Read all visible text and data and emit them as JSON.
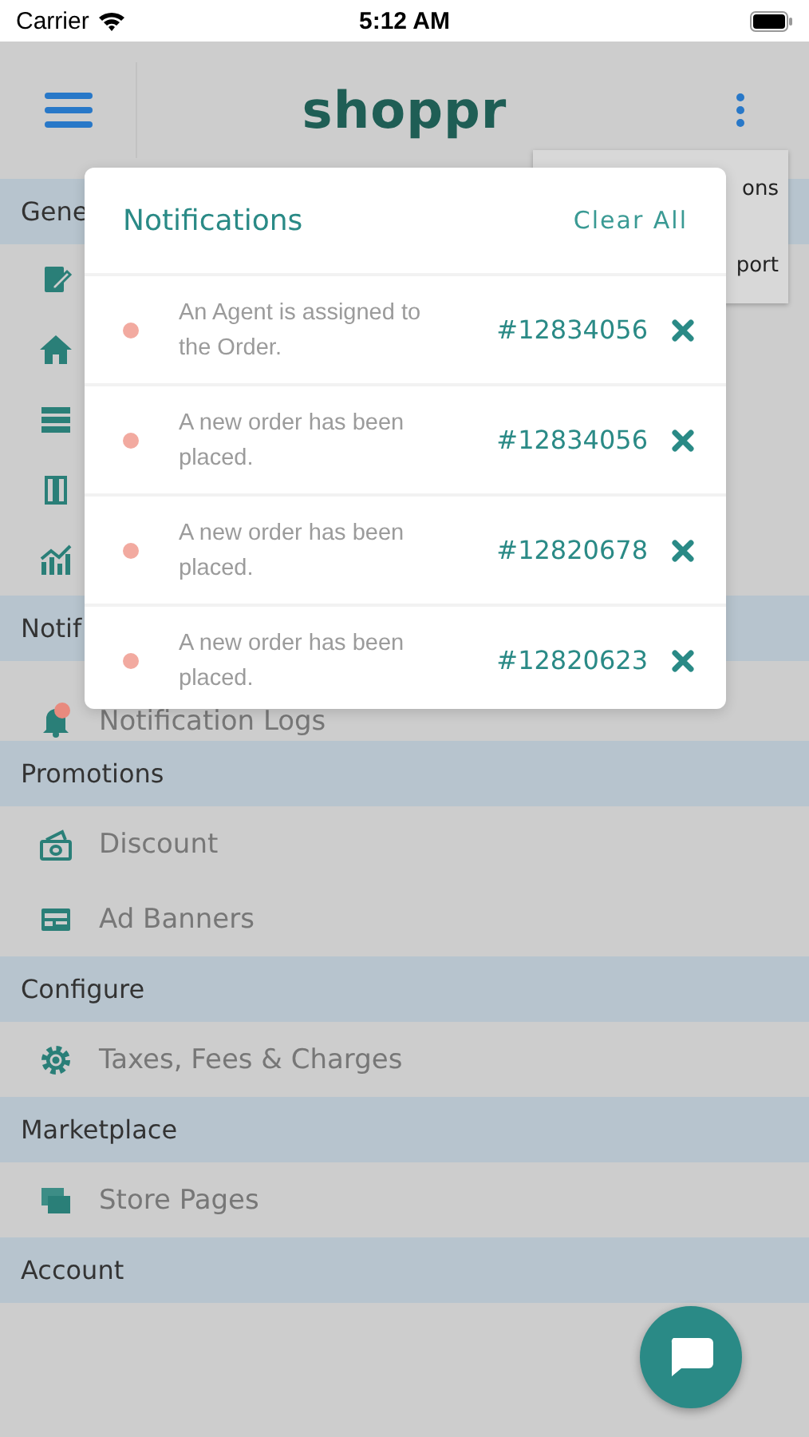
{
  "status_bar": {
    "carrier": "Carrier",
    "time": "5:12 AM"
  },
  "header": {
    "logo": "shoppr"
  },
  "overflow_menu": {
    "items": [
      "ons",
      "port"
    ]
  },
  "sidebar": {
    "sections": [
      {
        "title": "Gene",
        "kind": "icons"
      },
      {
        "title": "Notif",
        "items": [
          {
            "label": "Notification Logs"
          }
        ]
      },
      {
        "title": "Promotions",
        "items": [
          {
            "label": "Discount"
          },
          {
            "label": "Ad Banners"
          }
        ]
      },
      {
        "title": "Configure",
        "items": [
          {
            "label": "Taxes, Fees & Charges"
          }
        ]
      },
      {
        "title": "Marketplace",
        "items": [
          {
            "label": "Store Pages"
          }
        ]
      },
      {
        "title": "Account"
      }
    ]
  },
  "notifications": {
    "title": "Notifications",
    "clear": "Clear All",
    "items": [
      {
        "message": "An Agent is assigned to the Order.",
        "order": "#12834056",
        "unread": true
      },
      {
        "message": "A new order has been placed.",
        "order": "#12834056",
        "unread": true
      },
      {
        "message": "A new order has been placed.",
        "order": "#12820678",
        "unread": true
      },
      {
        "message": "A new order has been placed.",
        "order": "#12820623",
        "unread": true
      }
    ]
  }
}
